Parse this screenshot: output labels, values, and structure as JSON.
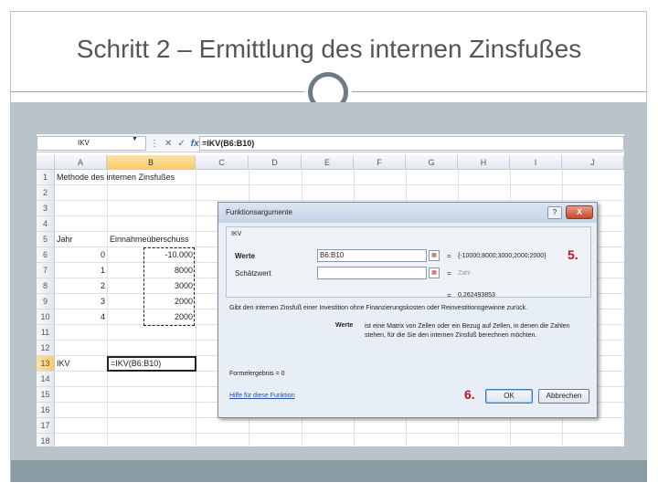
{
  "slide": {
    "title": "Schritt 2 – Ermittlung des internen Zinsfußes"
  },
  "colors": {
    "accent": "#6c7c84",
    "content_background": "#b8c4ca",
    "annotation": "#c0101a"
  },
  "excel": {
    "name_box": "IKV",
    "formula": "=IKV(B6:B10)",
    "formula_bar_icons": [
      "chevron-down-icon",
      "cancel-x-icon",
      "confirm-check-icon",
      "fx-icon"
    ],
    "columns": [
      "A",
      "B",
      "C",
      "D",
      "E",
      "F",
      "G",
      "H",
      "I",
      "J"
    ],
    "rows": [
      "1",
      "2",
      "3",
      "4",
      "5",
      "6",
      "7",
      "8",
      "9",
      "10",
      "11",
      "12",
      "13",
      "14",
      "15",
      "16",
      "17",
      "18"
    ],
    "cells": {
      "a1": "Methode des internen Zinsfußes",
      "a5": "Jahr",
      "b5": "Einnahmeüberschuss",
      "years": [
        "0",
        "1",
        "2",
        "3",
        "4"
      ],
      "values": [
        "-10.000",
        "8000",
        "3000",
        "2000",
        "2000"
      ],
      "a13": "IKV",
      "b13": "=IKV(B6:B10)"
    }
  },
  "dialog": {
    "title": "Funktionsargumente",
    "help_button": "?",
    "close_button": "X",
    "function_name": "IKV",
    "field1_label": "Werte",
    "field1_value": "B6:B10",
    "field1_eq": "=",
    "field1_result": "{-10000;8000;3000;2000;2000}",
    "field2_label": "Schätzwert",
    "field2_value": "",
    "field2_eq": "=",
    "field2_result": "Zahl",
    "total_eq": "=",
    "total_result": "0,262493853",
    "description": "Gibt den internen Zinsfuß einer Investition ohne Finanzierungskosten oder Reinvestitionsgewinne zurück.",
    "arg_label": "Werte",
    "arg_description": "ist eine Matrix von Zellen oder ein Bezug auf Zellen, in denen die Zahlen stehen, für die Sie den internen Zinsfuß berechnen möchten.",
    "formula_result": "Formelergebnis = 0",
    "help_link": "Hilfe für diese Funktion",
    "ok_button": "OK",
    "cancel_button": "Abbrechen"
  },
  "annotations": {
    "step5": "5.",
    "step6": "6."
  }
}
